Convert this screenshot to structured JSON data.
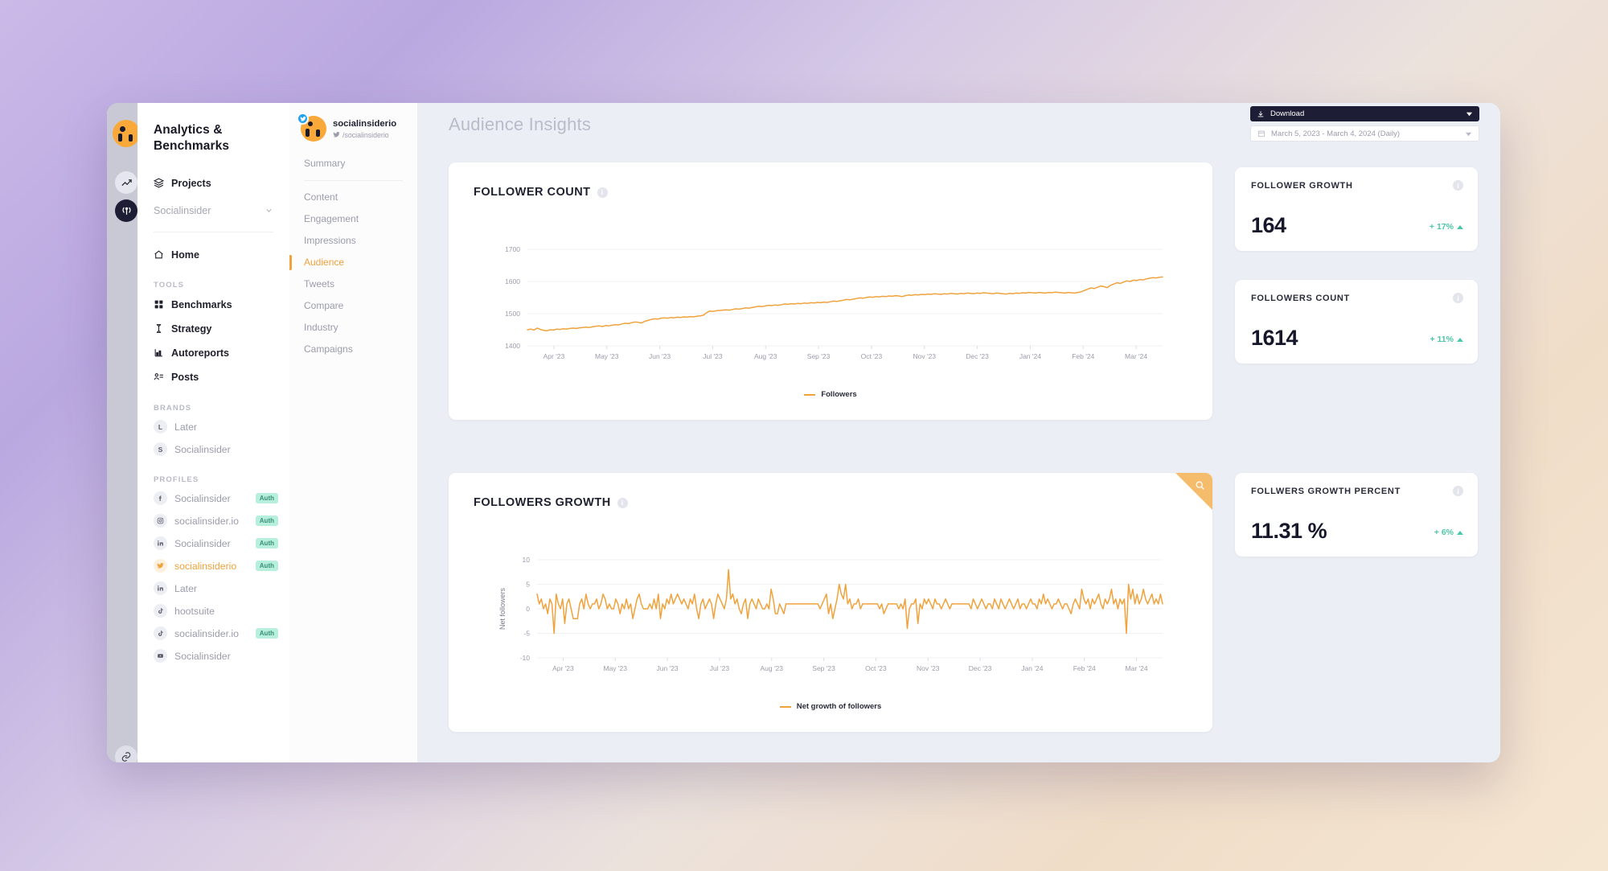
{
  "rail": {
    "logo": "socialinsider-logo",
    "items": [
      {
        "name": "analytics",
        "icon": "chart-line-icon"
      },
      {
        "name": "listening",
        "icon": "broadcast-icon"
      },
      {
        "name": "integrations",
        "icon": "link-icon"
      },
      {
        "name": "notifications",
        "icon": "bell-icon"
      },
      {
        "name": "account",
        "icon": "user-circle-icon"
      }
    ]
  },
  "sidebar": {
    "app_title": "Analytics & Benchmarks",
    "projects_label": "Projects",
    "workspace": "Socialinsider",
    "home_label": "Home",
    "tools_label": "TOOLS",
    "tools": [
      {
        "label": "Benchmarks",
        "icon": "grid-icon"
      },
      {
        "label": "Strategy",
        "icon": "chess-icon"
      },
      {
        "label": "Autoreports",
        "icon": "bar-chart-icon"
      },
      {
        "label": "Posts",
        "icon": "posts-icon"
      }
    ],
    "brands_label": "BRANDS",
    "brands": [
      {
        "label": "Later",
        "initial": "L"
      },
      {
        "label": "Socialinsider",
        "initial": "S"
      }
    ],
    "profiles_label": "PROFILES",
    "profiles": [
      {
        "label": "Socialinsider",
        "network": "facebook",
        "badge": "Auth",
        "active": false
      },
      {
        "label": "socialinsider.io",
        "network": "instagram",
        "badge": "Auth",
        "active": false
      },
      {
        "label": "Socialinsider",
        "network": "linkedin",
        "badge": "Auth",
        "active": false
      },
      {
        "label": "socialinsiderio",
        "network": "twitter",
        "badge": "Auth",
        "active": true
      },
      {
        "label": "Later",
        "network": "linkedin",
        "badge": "",
        "active": false
      },
      {
        "label": "hootsuite",
        "network": "tiktok",
        "badge": "",
        "active": false
      },
      {
        "label": "socialinsider.io",
        "network": "tiktok",
        "badge": "Auth",
        "active": false
      },
      {
        "label": "Socialinsider",
        "network": "youtube",
        "badge": "",
        "active": false
      }
    ]
  },
  "profile_panel": {
    "name": "socialinsiderio",
    "handle": "/socialinsiderio",
    "network": "twitter",
    "summary_label": "Summary",
    "nav": [
      {
        "label": "Content",
        "active": false
      },
      {
        "label": "Engagement",
        "active": false
      },
      {
        "label": "Impressions",
        "active": false
      },
      {
        "label": "Audience",
        "active": true
      },
      {
        "label": "Tweets",
        "active": false
      },
      {
        "label": "Compare",
        "active": false
      },
      {
        "label": "Industry",
        "active": false
      },
      {
        "label": "Campaigns",
        "active": false
      }
    ]
  },
  "header": {
    "title": "Audience Insights",
    "download_label": "Download",
    "date_range": "March 5, 2023 - March 4, 2024 (Daily)"
  },
  "cards": {
    "follower_count_title": "FOLLOWER COUNT",
    "followers_growth_title": "FOLLOWERS GROWTH"
  },
  "kpis": [
    {
      "label": "FOLLOWER GROWTH",
      "value": "164",
      "delta": "+ 17%",
      "direction": "up"
    },
    {
      "label": "FOLLOWERS COUNT",
      "value": "1614",
      "delta": "+ 11%",
      "direction": "up"
    },
    {
      "label": "FOLLWERS GROWTH PERCENT",
      "value": "11.31 %",
      "delta": "+ 6%",
      "direction": "up"
    }
  ],
  "colors": {
    "accent": "#f0a23c",
    "positive": "#4ec6a8",
    "dark": "#1d1d35",
    "badge": "#b6f0dd"
  },
  "chart_data": [
    {
      "type": "line",
      "title": "FOLLOWER COUNT",
      "xlabel": "",
      "ylabel": "",
      "ylim": [
        1400,
        1700
      ],
      "yticks": [
        1400,
        1500,
        1600,
        1700
      ],
      "grid": true,
      "legend": "Followers",
      "legend_position": "bottom",
      "xticks": [
        "Apr '23",
        "May '23",
        "Jun '23",
        "Jul '23",
        "Aug '23",
        "Sep '23",
        "Oct '23",
        "Nov '23",
        "Dec '23",
        "Jan '24",
        "Feb '24",
        "Mar '24"
      ],
      "series": [
        {
          "name": "Followers",
          "color": "#f0a23c",
          "values": [
            1450,
            1452,
            1449,
            1455,
            1451,
            1448,
            1447,
            1450,
            1449,
            1452,
            1451,
            1453,
            1452,
            1454,
            1455,
            1454,
            1456,
            1457,
            1458,
            1457,
            1459,
            1461,
            1462,
            1460,
            1463,
            1462,
            1464,
            1466,
            1465,
            1468,
            1470,
            1469,
            1472,
            1474,
            1473,
            1471,
            1476,
            1479,
            1482,
            1484,
            1483,
            1486,
            1487,
            1486,
            1488,
            1487,
            1489,
            1488,
            1490,
            1489,
            1491,
            1490,
            1492,
            1493,
            1495,
            1503,
            1508,
            1507,
            1509,
            1510,
            1511,
            1512,
            1511,
            1513,
            1515,
            1514,
            1516,
            1518,
            1517,
            1519,
            1521,
            1523,
            1522,
            1524,
            1526,
            1525,
            1527,
            1526,
            1528,
            1530,
            1529,
            1531,
            1530,
            1532,
            1531,
            1533,
            1532,
            1534,
            1533,
            1535,
            1534,
            1536,
            1535,
            1537,
            1539,
            1538,
            1540,
            1542,
            1544,
            1543,
            1545,
            1547,
            1549,
            1548,
            1550,
            1552,
            1551,
            1553,
            1552,
            1554,
            1553,
            1555,
            1554,
            1556,
            1555,
            1553,
            1556,
            1558,
            1557,
            1559,
            1558,
            1560,
            1559,
            1561,
            1560,
            1562,
            1561,
            1560,
            1562,
            1561,
            1563,
            1562,
            1561,
            1563,
            1562,
            1564,
            1563,
            1562,
            1564,
            1563,
            1565,
            1564,
            1563,
            1562,
            1564,
            1563,
            1562,
            1561,
            1563,
            1562,
            1564,
            1563,
            1565,
            1564,
            1566,
            1565,
            1564,
            1566,
            1565,
            1564,
            1566,
            1565,
            1567,
            1566,
            1565,
            1564,
            1566,
            1565,
            1564,
            1566,
            1568,
            1572,
            1576,
            1580,
            1578,
            1582,
            1586,
            1584,
            1581,
            1588,
            1592,
            1596,
            1594,
            1598,
            1602,
            1600,
            1604,
            1603,
            1606,
            1605,
            1608,
            1610,
            1612,
            1611,
            1613,
            1614
          ]
        }
      ]
    },
    {
      "type": "line",
      "title": "FOLLOWERS GROWTH",
      "xlabel": "",
      "ylabel": "Net followers",
      "ylim": [
        -10,
        10
      ],
      "yticks": [
        -10,
        -5,
        0,
        5,
        10
      ],
      "grid": true,
      "legend": "Net growth of followers",
      "legend_position": "bottom",
      "xticks": [
        "Apr '23",
        "May '23",
        "Jun '23",
        "Jul '23",
        "Aug '23",
        "Sep '23",
        "Oct '23",
        "Nov '23",
        "Dec '23",
        "Jan '24",
        "Feb '24",
        "Mar '24"
      ],
      "series": [
        {
          "name": "Net growth of followers",
          "color": "#f0a23c",
          "values": [
            3,
            1,
            2,
            0,
            1,
            -1,
            2,
            1,
            -5,
            3,
            1,
            0,
            2,
            -3,
            1,
            2,
            0,
            -2,
            -2,
            -2,
            1,
            2,
            0,
            3,
            1,
            0,
            1,
            1,
            2,
            0,
            1,
            3,
            2,
            0,
            1,
            0,
            0,
            2,
            1,
            -1,
            1,
            0,
            2,
            0,
            1,
            -2,
            0,
            2,
            3,
            1,
            0,
            0,
            0,
            1,
            0,
            2,
            0,
            3,
            -2,
            1,
            0,
            2,
            1,
            3,
            1,
            2,
            3,
            2,
            1,
            2,
            1,
            0,
            2,
            1,
            3,
            0,
            -2,
            1,
            2,
            0,
            1,
            2,
            1,
            -2,
            1,
            3,
            2,
            1,
            0,
            2,
            8,
            2,
            3,
            1,
            2,
            0,
            -1,
            1,
            2,
            -2,
            1,
            2,
            1,
            0,
            2,
            1,
            0,
            0,
            1,
            0,
            4,
            2,
            -1,
            -1,
            1,
            0,
            -1,
            1,
            1,
            1,
            1,
            1,
            1,
            1,
            1,
            1,
            1,
            1,
            1,
            1,
            1,
            1,
            1,
            0,
            1,
            2,
            3,
            -1,
            1,
            -2,
            0,
            2,
            5,
            3,
            2,
            5,
            1,
            2,
            0,
            1,
            1,
            2,
            0,
            1,
            1,
            1,
            1,
            1,
            1,
            1,
            1,
            0,
            1,
            -1,
            0,
            1,
            1,
            1,
            1,
            1,
            0,
            1,
            0,
            2,
            -4,
            0,
            1,
            1,
            2,
            -3,
            1,
            0,
            2,
            1,
            2,
            1,
            0,
            2,
            1,
            1,
            0,
            1,
            2,
            1,
            0,
            1,
            1,
            1,
            1,
            1,
            1,
            1,
            1,
            1,
            0,
            2,
            1,
            0,
            1,
            2,
            1,
            0,
            1,
            1,
            0,
            2,
            1,
            0,
            2,
            1,
            0,
            1,
            2,
            1,
            0,
            1,
            2,
            0,
            1,
            1,
            0,
            1,
            2,
            1,
            1,
            0,
            2,
            1,
            3,
            1,
            2,
            1,
            0,
            1,
            1,
            2,
            1,
            0,
            1,
            1,
            0,
            -1,
            1,
            2,
            1,
            0,
            4,
            2,
            1,
            2,
            0,
            2,
            1,
            2,
            3,
            1,
            0,
            2,
            1,
            2,
            4,
            1,
            2,
            0,
            2,
            1,
            2,
            -5,
            5,
            2,
            4,
            1,
            3,
            1,
            2,
            4,
            2,
            1,
            2,
            3,
            1,
            2,
            1,
            3,
            1
          ]
        }
      ]
    }
  ]
}
